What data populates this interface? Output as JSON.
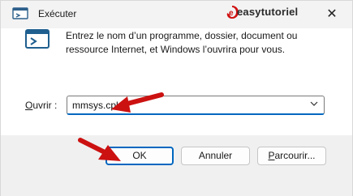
{
  "window": {
    "title": "Exécuter",
    "close_label": "✕"
  },
  "watermark": {
    "text": "easytutoriel",
    "badge_letter": "e",
    "accent": "#d01010"
  },
  "dialog": {
    "description": "Entrez le nom d’un programme, dossier, document ou ressource Internet, et Windows l’ouvrira pour vous.",
    "open_label_underlined": "O",
    "open_label_rest": "uvrir :",
    "open_value": "mmsys.cpl"
  },
  "buttons": {
    "ok": "OK",
    "cancel": "Annuler",
    "browse_underlined": "P",
    "browse_rest": "arcourir..."
  },
  "colors": {
    "accent": "#0067c0",
    "arrow": "#cc1111"
  }
}
